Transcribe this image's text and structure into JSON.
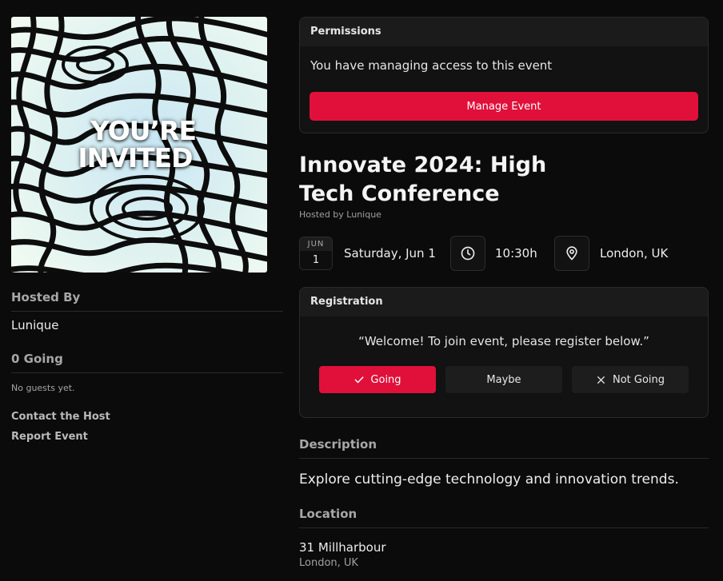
{
  "poster": {
    "line1": "YOU’RE",
    "line2": "INVITED"
  },
  "sidebar": {
    "hosted_by_heading": "Hosted By",
    "host_name": "Lunique",
    "going_heading": "0 Going",
    "no_guests": "No guests yet.",
    "contact_link": "Contact the Host",
    "report_link": "Report Event"
  },
  "permissions": {
    "heading": "Permissions",
    "message": "You have managing access to this event",
    "manage_button": "Manage Event"
  },
  "event": {
    "title": "Innovate 2024: High Tech Conference",
    "hosted_by": "Hosted by Lunique",
    "month": "JUN",
    "day": "1",
    "date": "Saturday, Jun 1",
    "time": "10:30h",
    "location": "London, UK"
  },
  "registration": {
    "heading": "Registration",
    "message": "“Welcome! To join event, please register below.”",
    "going_label": "Going",
    "maybe_label": "Maybe",
    "not_going_label": "Not Going",
    "selected": "Going"
  },
  "description": {
    "heading": "Description",
    "text": "Explore cutting-edge technology and innovation trends."
  },
  "location_section": {
    "heading": "Location",
    "address": "31 Millharbour",
    "city": "London, UK"
  },
  "icons": {
    "clock": "clock-icon",
    "pin": "map-pin-icon",
    "check": "check-icon",
    "x": "x-icon"
  },
  "colors": {
    "accent": "#e0103a",
    "background": "#0b0b0b",
    "card": "#121212"
  }
}
